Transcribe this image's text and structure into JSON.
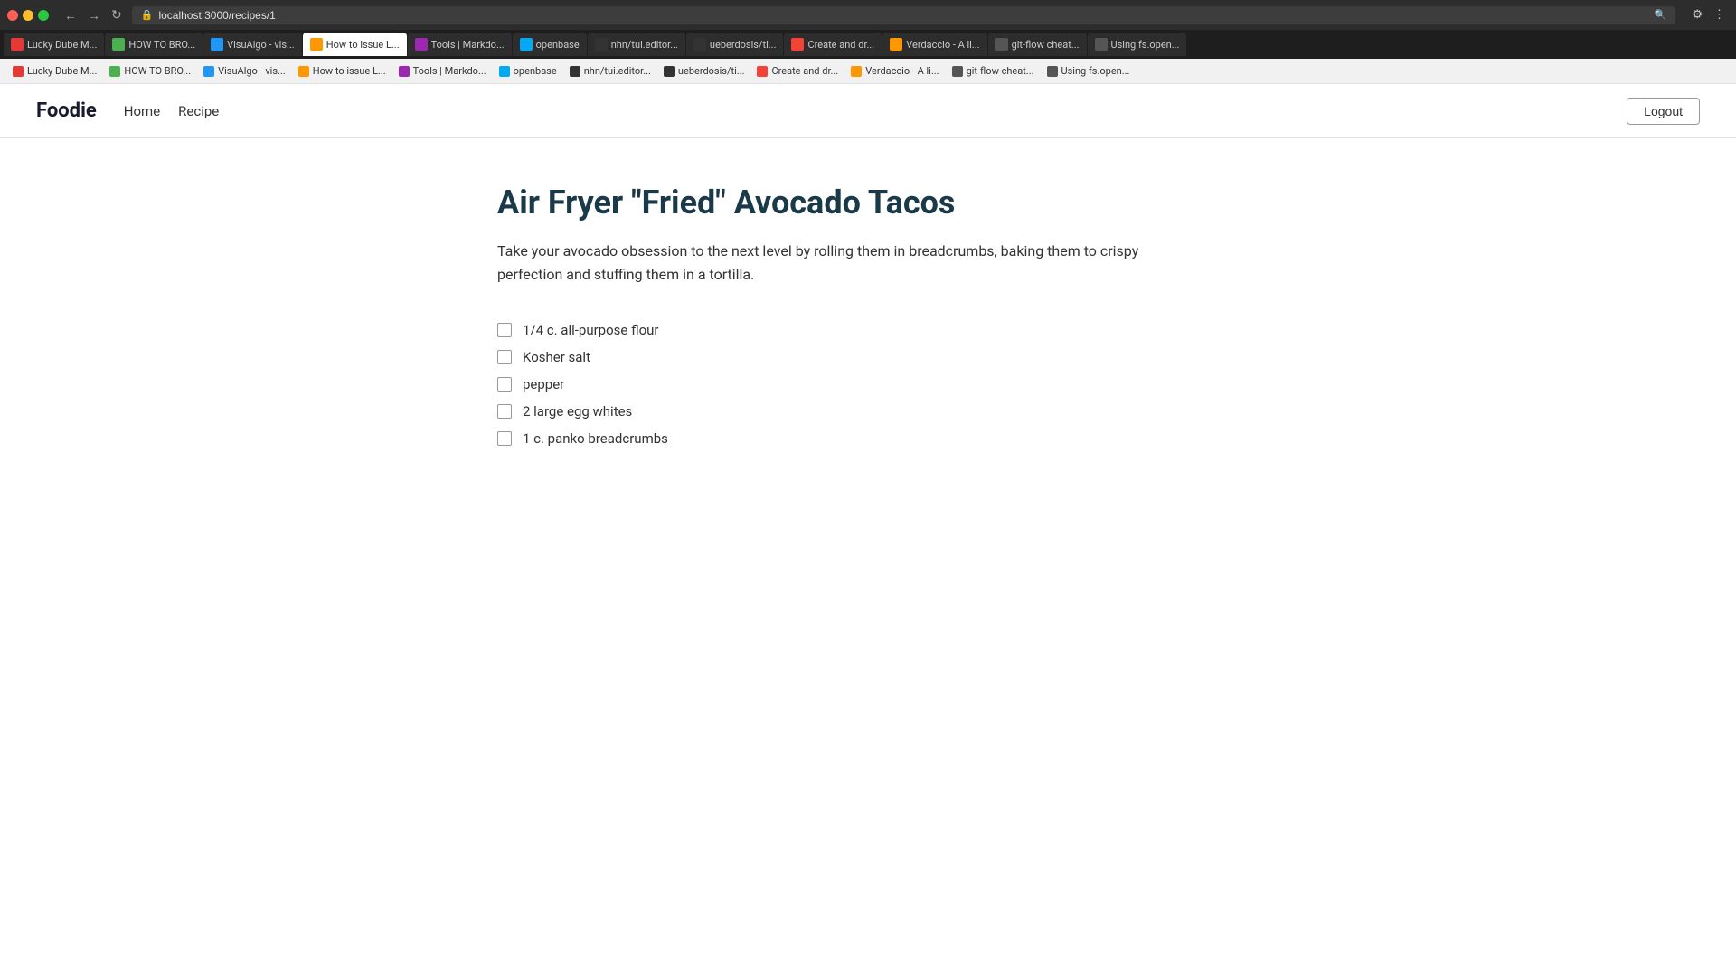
{
  "browser": {
    "url": "localhost:3000/recipes/1",
    "tabs": [
      {
        "id": "t1",
        "label": "Lucky Dube M...",
        "favicon_color": "#e53935",
        "active": false
      },
      {
        "id": "t2",
        "label": "HOW TO BRO...",
        "favicon_color": "#4caf50",
        "active": false
      },
      {
        "id": "t3",
        "label": "VisuAlgo - vis...",
        "favicon_color": "#2196f3",
        "active": false
      },
      {
        "id": "t4",
        "label": "How to issue L...",
        "favicon_color": "#ff9800",
        "active": true
      },
      {
        "id": "t5",
        "label": "Tools | Markdo...",
        "favicon_color": "#9c27b0",
        "active": false
      },
      {
        "id": "t6",
        "label": "openbase",
        "favicon_color": "#03a9f4",
        "active": false
      },
      {
        "id": "t7",
        "label": "nhn/tui.editor...",
        "favicon_color": "#333",
        "active": false
      },
      {
        "id": "t8",
        "label": "ueberdosis/ti...",
        "favicon_color": "#333",
        "active": false
      },
      {
        "id": "t9",
        "label": "Create and dr...",
        "favicon_color": "#f44336",
        "active": false
      },
      {
        "id": "t10",
        "label": "Verdaccio - A li...",
        "favicon_color": "#ff9800",
        "active": false
      },
      {
        "id": "t11",
        "label": "git-flow cheat...",
        "favicon_color": "#333",
        "active": false
      },
      {
        "id": "t12",
        "label": "Using fs.open...",
        "favicon_color": "#333",
        "active": false
      }
    ],
    "bookmarks": [
      {
        "label": "Lucky Dube M...",
        "favicon_color": "#e53935"
      },
      {
        "label": "HOW TO BRO...",
        "favicon_color": "#4caf50"
      },
      {
        "label": "VisuAlgo - vis...",
        "favicon_color": "#2196f3"
      },
      {
        "label": "How to issue L...",
        "favicon_color": "#ff9800"
      },
      {
        "label": "Tools | Markdo...",
        "favicon_color": "#9c27b0"
      },
      {
        "label": "openbase",
        "favicon_color": "#03a9f4"
      },
      {
        "label": "nhn/tui.editor...",
        "favicon_color": "#333"
      },
      {
        "label": "ueberdosis/ti...",
        "favicon_color": "#333"
      },
      {
        "label": "Create and dr...",
        "favicon_color": "#f44336"
      },
      {
        "label": "Verdaccio - A li...",
        "favicon_color": "#ff9800"
      },
      {
        "label": "git-flow cheat...",
        "favicon_color": "#333"
      },
      {
        "label": "Using fs.open...",
        "favicon_color": "#333"
      }
    ]
  },
  "nav": {
    "brand": "Foodie",
    "links": [
      "Home",
      "Recipe"
    ],
    "logout_label": "Logout"
  },
  "recipe": {
    "title": "Air Fryer \"Fried\" Avocado Tacos",
    "description": "Take your avocado obsession to the next level by rolling them in breadcrumbs, baking them to crispy perfection and stuffing them in a tortilla.",
    "ingredients": [
      "1/4 c. all-purpose flour",
      "Kosher salt",
      "pepper",
      "2 large egg whites",
      "1 c. panko breadcrumbs"
    ]
  }
}
